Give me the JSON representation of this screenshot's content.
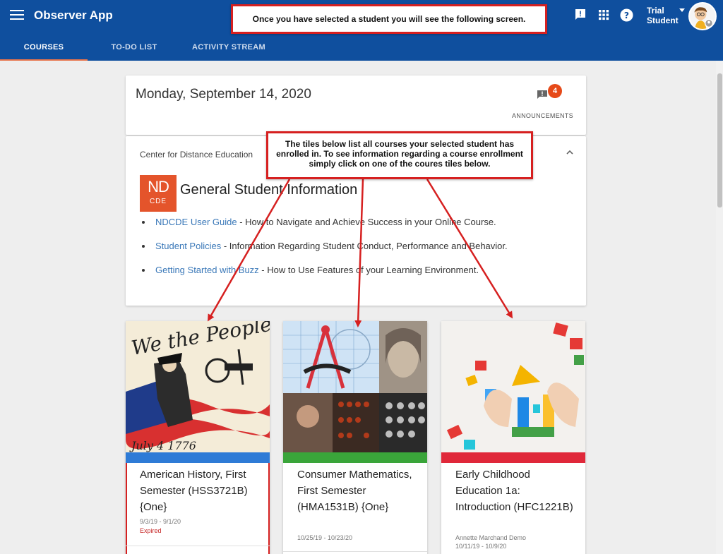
{
  "header": {
    "app_title": "Observer App",
    "tabs": [
      {
        "label": "COURSES"
      },
      {
        "label": "TO-DO LIST"
      },
      {
        "label": "ACTIVITY STREAM"
      }
    ],
    "user_first": "Trial",
    "user_last": "Student",
    "icons": [
      "menu-icon",
      "feedback-icon",
      "apps-grid-icon",
      "help-icon",
      "avatar"
    ],
    "color": "#0f4f9e"
  },
  "annotations": {
    "top": "Once you have selected a student you will see the following screen.",
    "middle": "The tiles below list all courses your selected student has enrolled in. To see information regarding a course enrollment simply click on one of the coures tiles below."
  },
  "date_card": {
    "date": "Monday, September 14, 2020",
    "announcements_count": "4",
    "announcements_label": "ANNOUNCEMENTS"
  },
  "info": {
    "heading": "Center for Distance Education",
    "logo_top": "ND",
    "logo_bottom": "CDE",
    "title": "General Student Information",
    "links": [
      {
        "link": "NDCDE User Guide",
        "text": " - How to Navigate and Achieve Success in your Online Course."
      },
      {
        "link": "Student Policies",
        "text": " - Information Regarding Student Conduct, Performance and Behavior."
      },
      {
        "link": "Getting Started with Buzz",
        "text": " - How to Use Features of your Learning Environment."
      }
    ]
  },
  "courses": [
    {
      "title": "American History, First Semester (HSS3721B) {One}",
      "date": "9/3/19 - 9/1/20",
      "status": "Expired",
      "teacher": "",
      "bar_color": "#2e7bd6"
    },
    {
      "title": "Consumer Mathematics, First Semester (HMA1531B) {One}",
      "date": "10/25/19 - 10/23/20",
      "status": "",
      "teacher": "",
      "bar_color": "#3aa53a"
    },
    {
      "title": "Early Childhood Education 1a: Introduction (HFC1221B)",
      "date": "10/11/19 - 10/9/20",
      "status": "",
      "teacher": "Annette Marchand Demo",
      "bar_color": "#e0283a"
    }
  ]
}
